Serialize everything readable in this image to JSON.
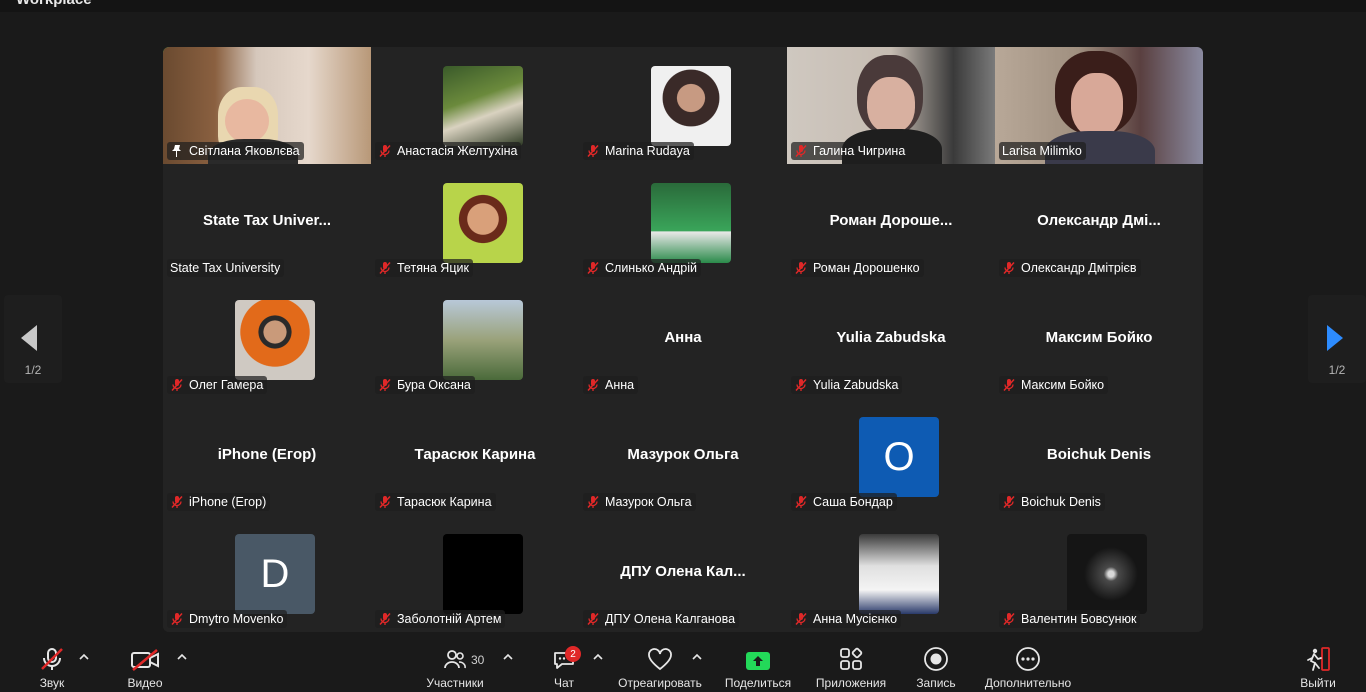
{
  "window": {
    "title": "Workplace"
  },
  "gallery": {
    "page_indicator_left": "1/2",
    "page_indicator_right": "1/2",
    "tiles": [
      {
        "name": "Світлана Яковлєва",
        "pinned": true,
        "active": true,
        "type": "video"
      },
      {
        "name": "Анастасія Желтухіна",
        "muted": true,
        "type": "photo"
      },
      {
        "name": "Marina Rudaya",
        "muted": true,
        "type": "photo"
      },
      {
        "name": "Галина Чигрина",
        "muted": true,
        "type": "video"
      },
      {
        "name": "Larisa Milimko",
        "muted": false,
        "type": "video"
      },
      {
        "name": "State Tax University",
        "display": "State Tax Univer...",
        "muted": false,
        "type": "name"
      },
      {
        "name": "Тетяна Яцик",
        "muted": true,
        "type": "photo"
      },
      {
        "name": "Слинько Андрій",
        "muted": true,
        "type": "photo"
      },
      {
        "name": "Роман Дорошенко",
        "display": "Роман  Дороше...",
        "muted": true,
        "type": "name"
      },
      {
        "name": "Олександр Дмітрієв",
        "display": "Олександр  Дмі...",
        "muted": true,
        "type": "name"
      },
      {
        "name": "Олег Гамера",
        "muted": true,
        "type": "photo"
      },
      {
        "name": "Бура Оксана",
        "muted": true,
        "type": "photo"
      },
      {
        "name": "Анна",
        "display": "Анна",
        "muted": true,
        "type": "name"
      },
      {
        "name": "Yulia Zabudska",
        "display": "Yulia Zabudska",
        "muted": true,
        "type": "name"
      },
      {
        "name": "Максим Бойко",
        "display": "Максим Бойко",
        "muted": true,
        "type": "name"
      },
      {
        "name": "iPhone (Егор)",
        "display": "iPhone (Егор)",
        "muted": true,
        "type": "name"
      },
      {
        "name": "Тарасюк Карина",
        "display": "Тарасюк Карина",
        "muted": true,
        "type": "name"
      },
      {
        "name": "Мазурок Ольга",
        "display": "Мазурок Ольга",
        "muted": true,
        "type": "name"
      },
      {
        "name": "Саша Бондар",
        "letter": "O",
        "letter_color": "#0e5bb3",
        "muted": true,
        "type": "letter"
      },
      {
        "name": "Boichuk Denis",
        "display": "Boichuk Denis",
        "muted": true,
        "type": "name"
      },
      {
        "name": "Dmytro Movenko",
        "letter": "D",
        "letter_color": "#495866",
        "muted": true,
        "type": "letter"
      },
      {
        "name": "Заболотній Артем",
        "muted": true,
        "type": "photo"
      },
      {
        "name": "ДПУ Олена Калганова",
        "display": "ДПУ  Олена  Кал...",
        "muted": true,
        "type": "name"
      },
      {
        "name": "Анна Мусієнко",
        "muted": true,
        "type": "photo"
      },
      {
        "name": "Валентин Бовсунюк",
        "muted": true,
        "type": "photo"
      }
    ]
  },
  "toolbar": {
    "audio_label": "Звук",
    "video_label": "Видео",
    "participants_label": "Участники",
    "participants_count": "30",
    "chat_label": "Чат",
    "chat_badge": "2",
    "react_label": "Отреагировать",
    "share_label": "Поделиться",
    "apps_label": "Приложения",
    "record_label": "Запись",
    "more_label": "Дополнительно",
    "leave_label": "Выйти"
  },
  "colors": {
    "active_speaker": "#23d959",
    "share_green": "#23d959",
    "leave_red": "#e02828",
    "muted_red": "#e02828"
  }
}
